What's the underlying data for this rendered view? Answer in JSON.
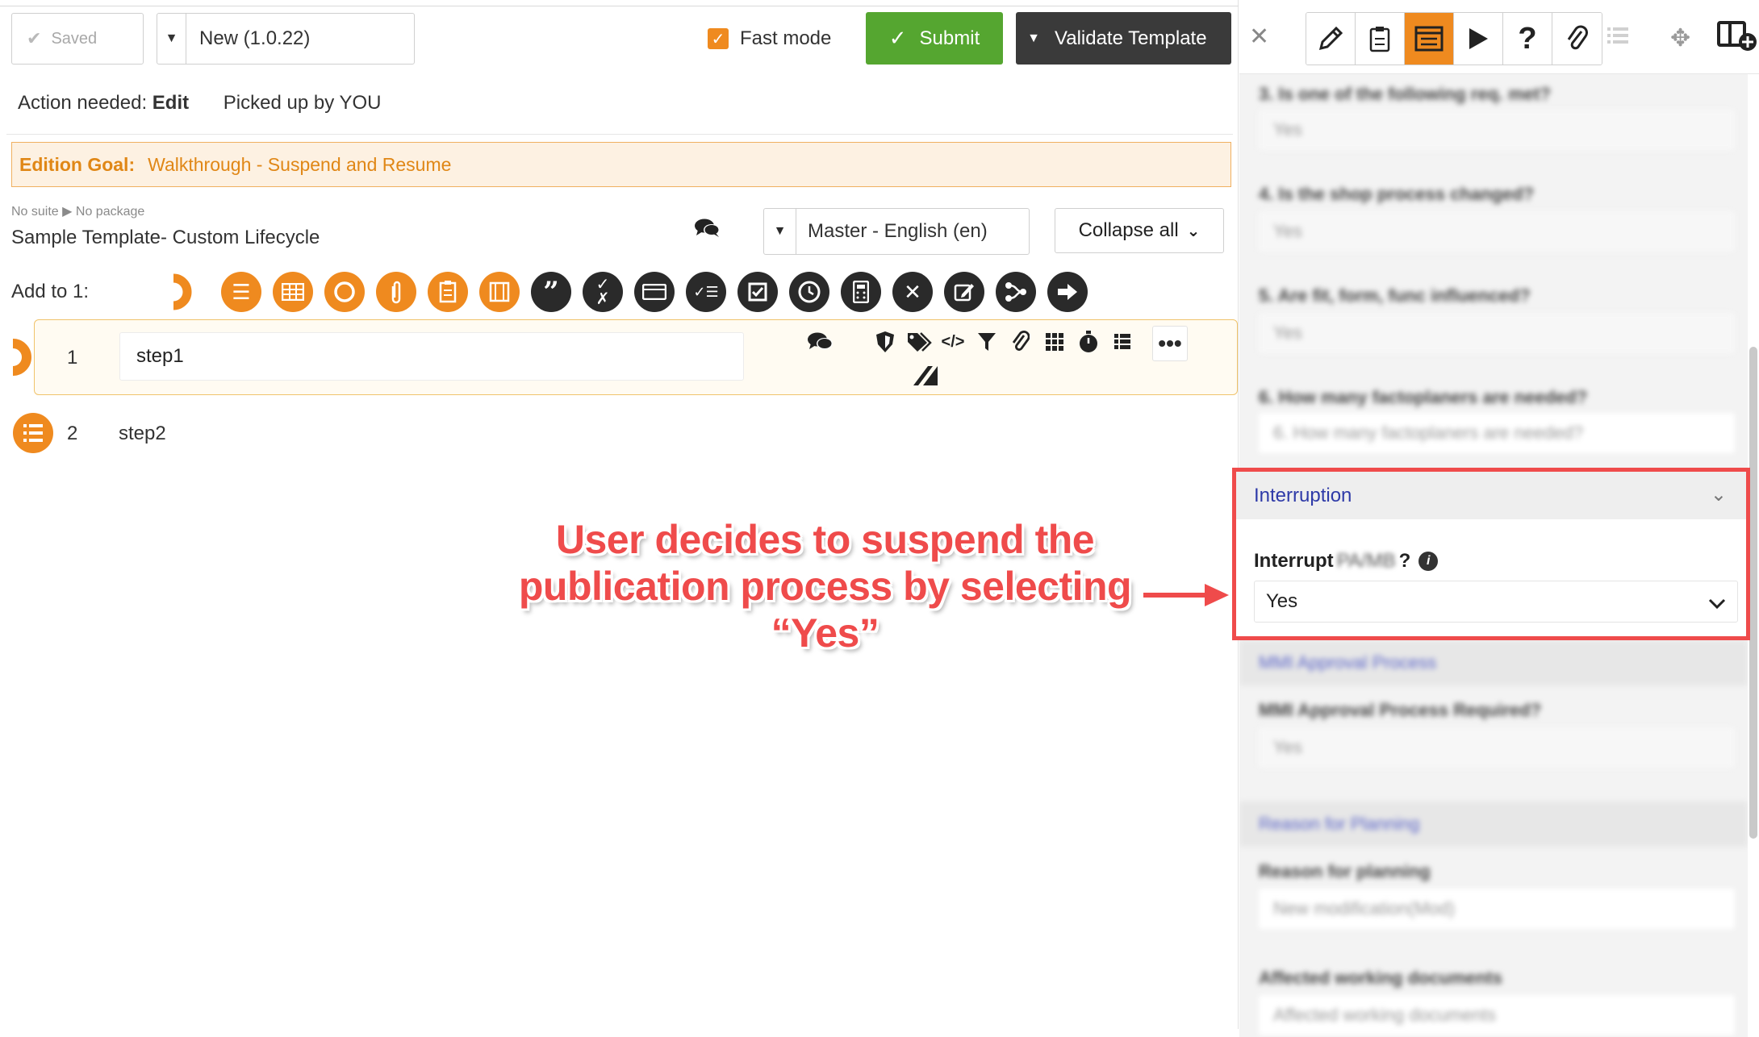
{
  "header": {
    "saved_label": "Saved",
    "version_value": "New (1.0.22)",
    "fast_mode_label": "Fast mode",
    "submit_label": "Submit",
    "validate_label": "Validate Template"
  },
  "status": {
    "action_prefix": "Action needed:",
    "action_value": "Edit",
    "picked_up": "Picked up by YOU"
  },
  "goal": {
    "label": "Edition Goal:",
    "value": "Walkthrough - Suspend and Resume"
  },
  "template": {
    "breadcrumb_suite": "No suite",
    "breadcrumb_package": "No package",
    "title": "Sample Template- Custom Lifecycle",
    "language": "Master - English (en)",
    "collapse_label": "Collapse all"
  },
  "add_to": {
    "label": "Add to 1:",
    "icons": [
      "step-icon",
      "list-icon",
      "table-icon",
      "circle-icon",
      "clip-icon",
      "checklist-icon",
      "film-icon",
      "quote-icon",
      "check-x-icon",
      "card-icon",
      "check-list-icon",
      "checkbox-icon",
      "clock-icon",
      "calculator-icon",
      "tools-icon",
      "edit-icon",
      "share-icon",
      "arrow-right-icon"
    ]
  },
  "steps": [
    {
      "number": "1",
      "label": "step1"
    },
    {
      "number": "2",
      "label": "step2"
    }
  ],
  "annotation": {
    "line1": "User decides to suspend the",
    "line2": "publication process by selecting",
    "line3": "“Yes”"
  },
  "right_panel": {
    "blurred": {
      "q3": "3. Is one of the following req. met?",
      "q3_value": "Yes",
      "q4": "4. Is the shop process changed?",
      "q4_value": "Yes",
      "q5": "5. Are fit, form, func influenced?",
      "q5_value": "Yes",
      "q6": "6. How many factoplaners are needed?",
      "q6_placeholder": "6. How many factoplaners are needed?",
      "sec_approval": "MMI Approval Process",
      "approval_q": "MMI Approval Process Required?",
      "approval_value": "Yes",
      "sec_reason": "Reason for Planning",
      "reason_q": "Reason for planning",
      "reason_value": "New modification(Mod)",
      "affected_q": "Affected working documents",
      "affected_placeholder": "Affected working documents"
    },
    "interruption": {
      "section_title": "Interruption",
      "question_prefix": "Interrupt",
      "question_blur": "PA/MB",
      "question_suffix": "?",
      "value": "Yes"
    }
  },
  "colors": {
    "accent_orange": "#ef8a1f",
    "submit_green": "#55a630",
    "annotation_red": "#ef4b4b",
    "dark": "#2a2a2a"
  }
}
